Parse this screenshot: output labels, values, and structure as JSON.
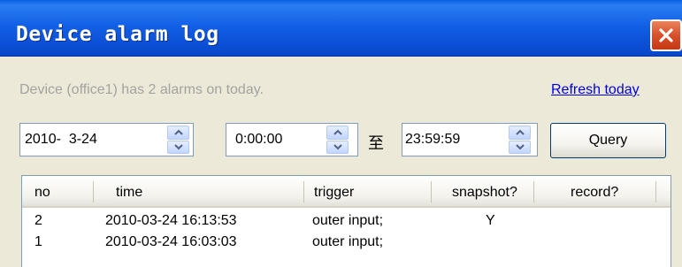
{
  "window": {
    "title": "Device alarm log"
  },
  "status": {
    "message": "Device (office1) has 2 alarms on today.",
    "refresh_label": "Refresh today"
  },
  "filters": {
    "date": "2010-  3-24",
    "start_time": "0:00:00",
    "separator": "至",
    "end_time": "23:59:59",
    "query_label": "Query"
  },
  "table": {
    "columns": [
      "no",
      "time",
      "trigger",
      "snapshot?",
      "record?"
    ],
    "rows": [
      {
        "no": "2",
        "time": "2010-03-24 16:13:53",
        "trigger": "outer input;",
        "snapshot": "Y",
        "record": ""
      },
      {
        "no": "1",
        "time": "2010-03-24 16:03:03",
        "trigger": "outer input;",
        "snapshot": "",
        "record": ""
      }
    ]
  },
  "colors": {
    "titlebar": "#0B4FD6",
    "close_button": "#D8502B",
    "link": "#0000EE",
    "disabled_text": "#A3A39F",
    "window_bg": "#ECE9D8"
  },
  "icons": [
    "close-icon",
    "spin-up-arrow-icon",
    "spin-down-arrow-icon"
  ]
}
